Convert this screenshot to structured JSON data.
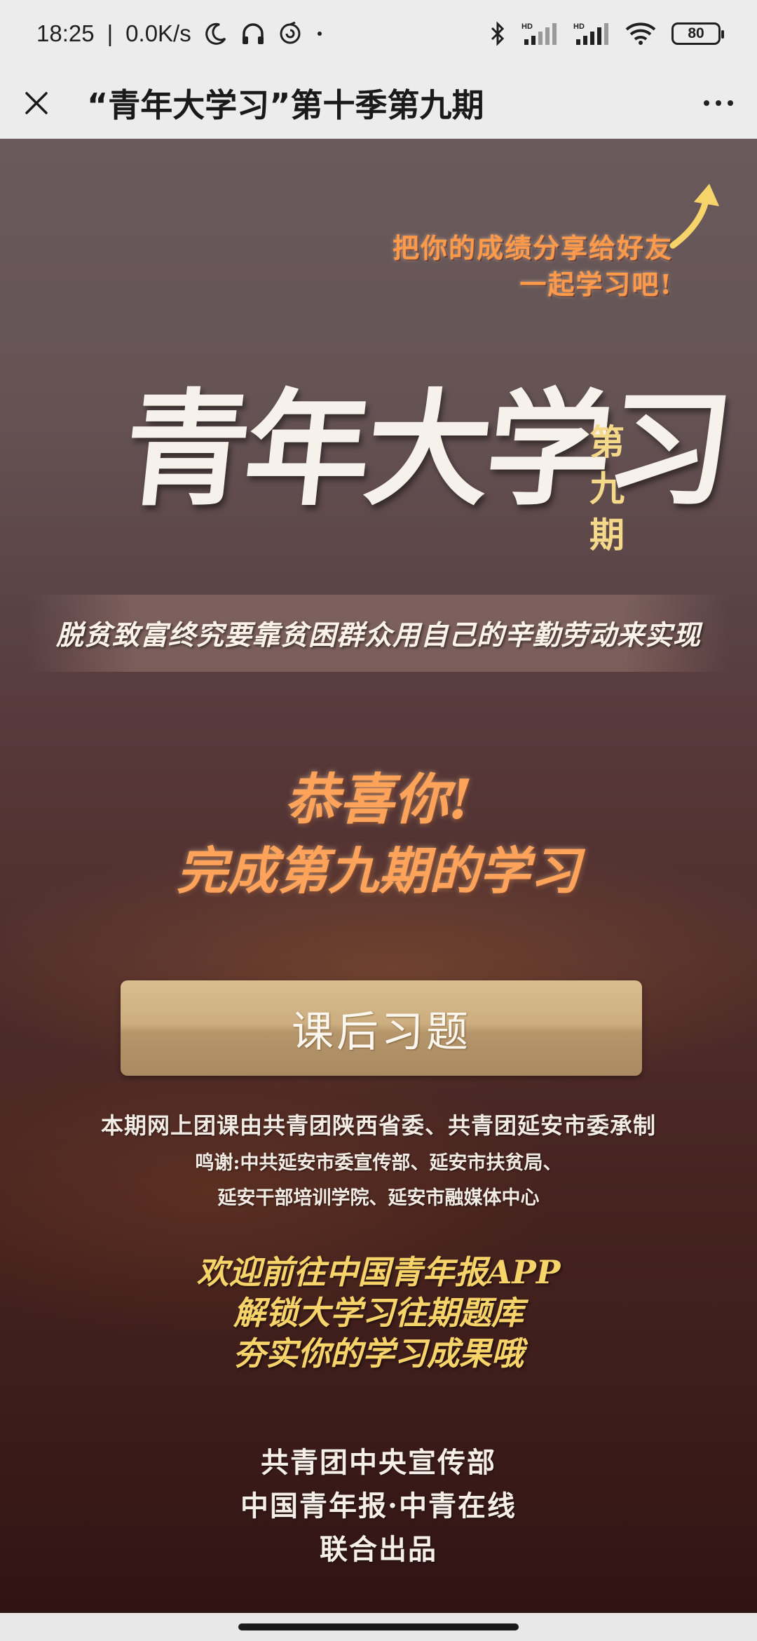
{
  "status_bar": {
    "time": "18:25",
    "separator": "|",
    "net_speed": "0.0K/s",
    "battery": "80",
    "icons": [
      "moon-icon",
      "headset-icon",
      "spiral-app-icon",
      "dot-icon",
      "bluetooth-icon",
      "hd-signal-icon",
      "hd-signal-icon",
      "wifi-icon",
      "battery-icon"
    ]
  },
  "title_bar": {
    "close_icon": "close-icon",
    "title": "“青年大学习”第十季第九期",
    "more_icon": "more-dots-icon"
  },
  "page": {
    "share_hint_line1": "把你的成绩分享给好友",
    "share_hint_line2": "一起学习吧!",
    "main_title": "青年大学习",
    "issue_chars": [
      "第",
      "九",
      "期"
    ],
    "subtitle": "脱贫致富终究要靠贫困群众用自己的辛勤劳动来实现",
    "congrats_line1": "恭喜你!",
    "congrats_line2": "完成第九期的学习",
    "quiz_button": "课后习题",
    "credits_line1": "本期网上团课由共青团陕西省委、共青团延安市委承制",
    "credits_line2": "鸣谢:中共延安市委宣传部、延安市扶贫局、",
    "credits_line3": "延安干部培训学院、延安市融媒体中心",
    "promo_line1": "欢迎前往中国青年报APP",
    "promo_line2": "解锁大学习往期题库",
    "promo_line3": "夯实你的学习成果哦",
    "producer_line1": "共青团中央宣传部",
    "producer_line2": "中国青年报·中青在线",
    "producer_line3": "联合出品"
  },
  "colors": {
    "accent_orange": "#ffa35a",
    "accent_yellow": "#f7d46a",
    "button_gold": "#ccae80"
  }
}
